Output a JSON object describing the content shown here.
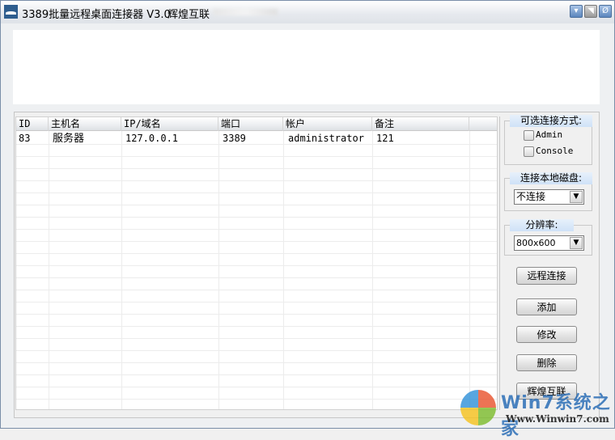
{
  "titlebar": {
    "title": "3389批量远程桌面连接器 V3.0",
    "brand": "辉煌互联",
    "buttons": {
      "minimize": "▾",
      "maximize": "◥",
      "close": "Ø"
    }
  },
  "table": {
    "columns": [
      "ID",
      "主机名",
      "IP/域名",
      "端口",
      "帐户",
      "备注"
    ],
    "rows": [
      {
        "id": "83",
        "host": "服务器",
        "ip": "127.0.0.1",
        "port": "3389",
        "account": "administrator",
        "note": "121"
      }
    ]
  },
  "options": {
    "connect_mode": {
      "label": "可选连接方式:",
      "admin": "Admin",
      "console": "Console",
      "admin_checked": false,
      "console_checked": false
    },
    "local_disk": {
      "label": "连接本地磁盘:",
      "value": "不连接"
    },
    "resolution": {
      "label": "分辨率:",
      "value": "800x600"
    }
  },
  "buttons": {
    "connect": "远程连接",
    "add": "添加",
    "edit": "修改",
    "delete": "删除",
    "brand": "辉煌互联"
  },
  "watermark": {
    "text": "Win7系统之家",
    "url": "Www.Winwin7.com"
  }
}
